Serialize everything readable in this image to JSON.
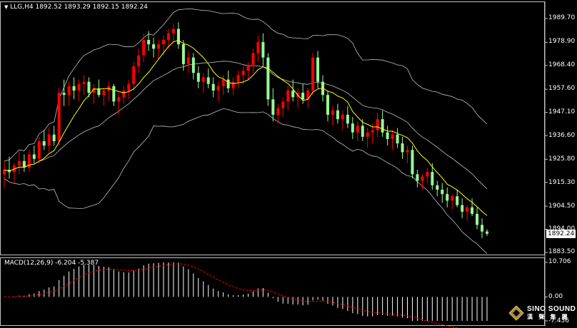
{
  "header": {
    "symbol_line": "LLG,H4  1892.52 1893.29 1892.15 1892.24",
    "macd_line": "MACD(12,26,9) -6.204 -5.387"
  },
  "price_axis": {
    "ticks": [
      "1989.70",
      "1978.90",
      "1968.40",
      "1957.60",
      "1947.10",
      "1936.60",
      "1925.80",
      "1915.30",
      "1904.50",
      "1894.00",
      "1883.50"
    ],
    "current_price": "1892.24"
  },
  "macd_axis": {
    "ticks": [
      "10.706",
      "0.00",
      "-7.436"
    ]
  },
  "logo": {
    "en": "SINO SOUND",
    "cn": "漢 聲 集 團"
  },
  "colors": {
    "up": "#ff0000",
    "down": "#98fb98",
    "ma": "#ffff00",
    "bands": "#c0c0c0",
    "signal": "#ff0000",
    "hist": "#ffffff",
    "grid": "#c0c0c0"
  },
  "chart_data": [
    {
      "type": "candlestick",
      "indicators": [
        "Bollinger Bands",
        "Moving Average"
      ],
      "ylim": [
        1883.5,
        1993.0
      ],
      "candles": [
        [
          1919,
          1925,
          1913,
          1921
        ],
        [
          1921,
          1927,
          1917,
          1920
        ],
        [
          1920,
          1924,
          1915,
          1923
        ],
        [
          1923,
          1929,
          1919,
          1925
        ],
        [
          1925,
          1928,
          1920,
          1922
        ],
        [
          1922,
          1930,
          1920,
          1928
        ],
        [
          1928,
          1932,
          1924,
          1926
        ],
        [
          1926,
          1936,
          1924,
          1934
        ],
        [
          1934,
          1939,
          1930,
          1932
        ],
        [
          1932,
          1940,
          1929,
          1937
        ],
        [
          1937,
          1941,
          1932,
          1934
        ],
        [
          1934,
          1958,
          1932,
          1956
        ],
        [
          1956,
          1962,
          1950,
          1955
        ],
        [
          1955,
          1961,
          1950,
          1959
        ],
        [
          1959,
          1963,
          1953,
          1957
        ],
        [
          1957,
          1962,
          1952,
          1960
        ],
        [
          1960,
          1964,
          1955,
          1961
        ],
        [
          1961,
          1963,
          1954,
          1956
        ],
        [
          1956,
          1960,
          1951,
          1958
        ],
        [
          1958,
          1962,
          1954,
          1955
        ],
        [
          1955,
          1958,
          1950,
          1957
        ],
        [
          1957,
          1961,
          1952,
          1959
        ],
        [
          1959,
          1960,
          1950,
          1952
        ],
        [
          1952,
          1956,
          1946,
          1954
        ],
        [
          1954,
          1959,
          1951,
          1957
        ],
        [
          1957,
          1962,
          1953,
          1960
        ],
        [
          1960,
          1970,
          1957,
          1968
        ],
        [
          1968,
          1976,
          1965,
          1973
        ],
        [
          1973,
          1983,
          1970,
          1980
        ],
        [
          1980,
          1984,
          1975,
          1978
        ],
        [
          1978,
          1981,
          1972,
          1976
        ],
        [
          1976,
          1980,
          1971,
          1978
        ],
        [
          1978,
          1982,
          1973,
          1980
        ],
        [
          1980,
          1985,
          1976,
          1983
        ],
        [
          1983,
          1987,
          1979,
          1985
        ],
        [
          1985,
          1988,
          1976,
          1978
        ],
        [
          1978,
          1980,
          1966,
          1969
        ],
        [
          1969,
          1975,
          1965,
          1972
        ],
        [
          1972,
          1974,
          1962,
          1965
        ],
        [
          1965,
          1968,
          1958,
          1961
        ],
        [
          1961,
          1965,
          1956,
          1963
        ],
        [
          1963,
          1967,
          1958,
          1960
        ],
        [
          1960,
          1963,
          1954,
          1957
        ],
        [
          1957,
          1961,
          1952,
          1959
        ],
        [
          1959,
          1964,
          1955,
          1962
        ],
        [
          1962,
          1966,
          1956,
          1958
        ],
        [
          1958,
          1963,
          1955,
          1961
        ],
        [
          1961,
          1966,
          1958,
          1964
        ],
        [
          1964,
          1968,
          1960,
          1966
        ],
        [
          1966,
          1970,
          1962,
          1968
        ],
        [
          1968,
          1976,
          1965,
          1974
        ],
        [
          1974,
          1982,
          1970,
          1979
        ],
        [
          1979,
          1983,
          1968,
          1972
        ],
        [
          1972,
          1974,
          1950,
          1953
        ],
        [
          1953,
          1958,
          1943,
          1946
        ],
        [
          1946,
          1951,
          1942,
          1949
        ],
        [
          1949,
          1954,
          1945,
          1952
        ],
        [
          1952,
          1959,
          1948,
          1957
        ],
        [
          1957,
          1962,
          1952,
          1954
        ],
        [
          1954,
          1958,
          1949,
          1956
        ],
        [
          1956,
          1960,
          1951,
          1953
        ],
        [
          1953,
          1958,
          1949,
          1957
        ],
        [
          1957,
          1974,
          1955,
          1972
        ],
        [
          1972,
          1975,
          1958,
          1961
        ],
        [
          1961,
          1964,
          1952,
          1955
        ],
        [
          1955,
          1957,
          1943,
          1946
        ],
        [
          1946,
          1950,
          1941,
          1948
        ],
        [
          1948,
          1951,
          1942,
          1944
        ],
        [
          1944,
          1948,
          1939,
          1946
        ],
        [
          1946,
          1950,
          1940,
          1942
        ],
        [
          1942,
          1945,
          1935,
          1938
        ],
        [
          1938,
          1943,
          1934,
          1941
        ],
        [
          1941,
          1944,
          1934,
          1936
        ],
        [
          1936,
          1940,
          1931,
          1938
        ],
        [
          1938,
          1942,
          1933,
          1939
        ],
        [
          1939,
          1947,
          1936,
          1944
        ],
        [
          1944,
          1948,
          1936,
          1938
        ],
        [
          1938,
          1941,
          1932,
          1935
        ],
        [
          1935,
          1939,
          1930,
          1937
        ],
        [
          1937,
          1940,
          1931,
          1933
        ],
        [
          1933,
          1936,
          1926,
          1929
        ],
        [
          1929,
          1932,
          1924,
          1930
        ],
        [
          1930,
          1932,
          1917,
          1919
        ],
        [
          1919,
          1921,
          1913,
          1916
        ],
        [
          1916,
          1919,
          1912,
          1918
        ],
        [
          1918,
          1922,
          1915,
          1920
        ],
        [
          1920,
          1924,
          1912,
          1914
        ],
        [
          1914,
          1916,
          1909,
          1912
        ],
        [
          1912,
          1915,
          1906,
          1910
        ],
        [
          1910,
          1913,
          1904,
          1907
        ],
        [
          1907,
          1910,
          1903,
          1909
        ],
        [
          1909,
          1912,
          1904,
          1905
        ],
        [
          1905,
          1908,
          1899,
          1902
        ],
        [
          1902,
          1905,
          1898,
          1904
        ],
        [
          1904,
          1908,
          1900,
          1901
        ],
        [
          1901,
          1904,
          1894,
          1896
        ],
        [
          1896,
          1899,
          1890,
          1893
        ],
        [
          1893,
          1894,
          1891,
          1892
        ]
      ]
    },
    {
      "type": "macd",
      "params": "12,26,9",
      "ylim": [
        -7.436,
        10.706
      ]
    }
  ]
}
